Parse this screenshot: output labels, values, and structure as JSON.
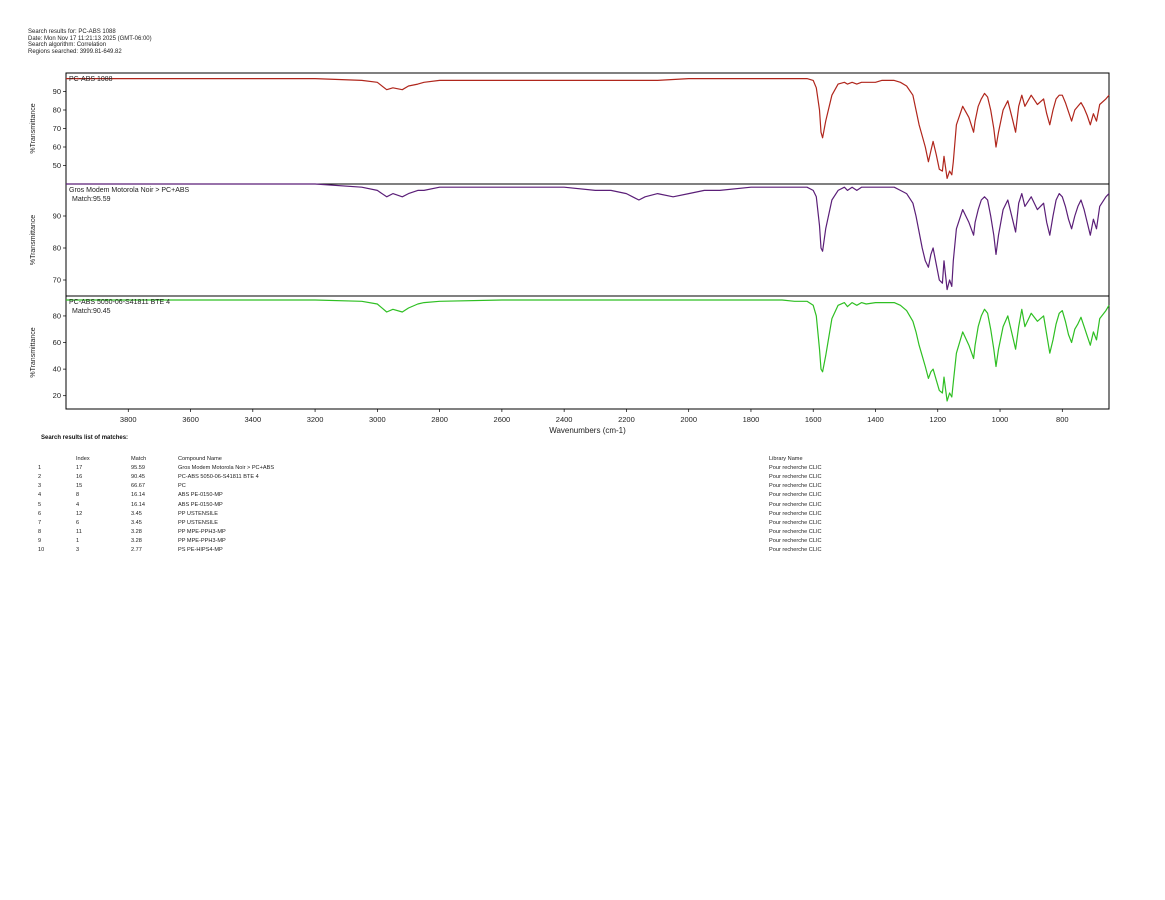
{
  "header": {
    "line1": "Search results for: PC-ABS 1088",
    "line2": "Date: Mon Nov 17 11:21:13 2025 (GMT-06:00)",
    "line3": "Search algorithm: Correlation",
    "line4": "Regions searched: 3999.81-649.82"
  },
  "chart_data": [
    {
      "type": "line",
      "label": "PC-ABS 1088",
      "match_label": "",
      "color": "#b0261c",
      "ylabel": "%Transmittance",
      "ylim": [
        40,
        100
      ],
      "yticks": [
        50,
        60,
        70,
        80,
        90
      ],
      "xlim": [
        4000,
        650
      ],
      "x": [
        4000,
        3700,
        3500,
        3200,
        3050,
        3000,
        2970,
        2950,
        2920,
        2900,
        2870,
        2850,
        2800,
        2600,
        2400,
        2300,
        2200,
        2100,
        2000,
        1900,
        1800,
        1700,
        1660,
        1620,
        1600,
        1590,
        1580,
        1575,
        1570,
        1560,
        1540,
        1520,
        1500,
        1490,
        1475,
        1460,
        1445,
        1430,
        1400,
        1380,
        1360,
        1340,
        1320,
        1300,
        1280,
        1270,
        1260,
        1250,
        1240,
        1230,
        1222,
        1215,
        1205,
        1195,
        1185,
        1180,
        1170,
        1162,
        1155,
        1150,
        1140,
        1120,
        1100,
        1085,
        1080,
        1070,
        1060,
        1050,
        1040,
        1030,
        1020,
        1013,
        1005,
        990,
        975,
        960,
        950,
        940,
        930,
        920,
        900,
        880,
        860,
        850,
        840,
        830,
        820,
        810,
        800,
        790,
        780,
        770,
        760,
        750,
        740,
        730,
        720,
        710,
        700,
        690,
        680,
        660,
        650
      ],
      "y": [
        97,
        97,
        97,
        97,
        96,
        95,
        91,
        92,
        91,
        93,
        94,
        95,
        96,
        96,
        96,
        96,
        96,
        96,
        97,
        97,
        97,
        97,
        97,
        97,
        96,
        92,
        80,
        68,
        65,
        74,
        88,
        94,
        95,
        94,
        95,
        94,
        95,
        95,
        95,
        96,
        96,
        96,
        95,
        93,
        88,
        80,
        72,
        66,
        60,
        52,
        58,
        63,
        56,
        48,
        47,
        55,
        43,
        47,
        45,
        52,
        72,
        82,
        76,
        68,
        74,
        82,
        86,
        89,
        87,
        80,
        70,
        60,
        68,
        80,
        85,
        75,
        68,
        82,
        88,
        82,
        88,
        83,
        86,
        78,
        72,
        80,
        86,
        88,
        88,
        84,
        79,
        74,
        80,
        82,
        84,
        81,
        77,
        72,
        78,
        74,
        83,
        86,
        88
      ]
    },
    {
      "type": "line",
      "label": "Gros Modem Motorola Noir > PC+ABS",
      "match_label": "Match:95.59",
      "color": "#5b1f78",
      "ylabel": "%Transmittance",
      "ylim": [
        65,
        100
      ],
      "yticks": [
        70,
        80,
        90
      ],
      "xlim": [
        4000,
        650
      ],
      "x": [
        4000,
        3700,
        3500,
        3200,
        3050,
        3000,
        2970,
        2950,
        2920,
        2900,
        2870,
        2850,
        2800,
        2600,
        2400,
        2300,
        2250,
        2200,
        2180,
        2160,
        2140,
        2100,
        2050,
        2000,
        1950,
        1900,
        1800,
        1700,
        1660,
        1620,
        1600,
        1590,
        1580,
        1575,
        1570,
        1560,
        1540,
        1520,
        1500,
        1490,
        1475,
        1460,
        1445,
        1430,
        1400,
        1380,
        1360,
        1340,
        1320,
        1300,
        1280,
        1270,
        1260,
        1250,
        1240,
        1230,
        1222,
        1215,
        1205,
        1195,
        1185,
        1180,
        1170,
        1162,
        1155,
        1150,
        1140,
        1120,
        1100,
        1085,
        1080,
        1070,
        1060,
        1050,
        1040,
        1030,
        1020,
        1013,
        1005,
        990,
        975,
        960,
        950,
        940,
        930,
        920,
        900,
        880,
        860,
        850,
        840,
        830,
        820,
        810,
        800,
        790,
        780,
        770,
        760,
        750,
        740,
        730,
        720,
        710,
        700,
        690,
        680,
        660,
        650
      ],
      "y": [
        100,
        100,
        100,
        100,
        99,
        98,
        96,
        97,
        96,
        97,
        98,
        98,
        99,
        99,
        99,
        98,
        98,
        97,
        96,
        95,
        96,
        97,
        96,
        97,
        98,
        98,
        99,
        99,
        99,
        99,
        98,
        96,
        87,
        80,
        79,
        86,
        95,
        98,
        99,
        98,
        99,
        98,
        99,
        99,
        99,
        99,
        99,
        99,
        98,
        97,
        94,
        90,
        85,
        80,
        76,
        74,
        78,
        80,
        75,
        70,
        69,
        76,
        67,
        70,
        68,
        76,
        86,
        92,
        88,
        84,
        88,
        92,
        95,
        96,
        95,
        90,
        84,
        78,
        84,
        92,
        95,
        89,
        85,
        94,
        97,
        93,
        96,
        92,
        94,
        88,
        84,
        90,
        95,
        97,
        96,
        93,
        89,
        86,
        90,
        93,
        95,
        92,
        88,
        84,
        89,
        86,
        93,
        96,
        97
      ]
    },
    {
      "type": "line",
      "label": "PC-ABS 5050-06-S41811 BTE 4",
      "match_label": "Match:90.45",
      "color": "#2fbf23",
      "ylabel": "%Transmittance",
      "ylim": [
        10,
        95
      ],
      "yticks": [
        20,
        40,
        60,
        80
      ],
      "xlim": [
        4000,
        650
      ],
      "x": [
        4000,
        3700,
        3500,
        3200,
        3050,
        3000,
        2970,
        2950,
        2920,
        2900,
        2870,
        2850,
        2800,
        2600,
        2400,
        2300,
        2200,
        2100,
        2000,
        1900,
        1800,
        1700,
        1660,
        1620,
        1600,
        1590,
        1580,
        1575,
        1570,
        1560,
        1540,
        1520,
        1500,
        1490,
        1475,
        1460,
        1445,
        1430,
        1400,
        1380,
        1360,
        1340,
        1320,
        1300,
        1280,
        1270,
        1260,
        1250,
        1240,
        1230,
        1222,
        1215,
        1205,
        1195,
        1185,
        1180,
        1170,
        1162,
        1155,
        1150,
        1140,
        1120,
        1100,
        1085,
        1080,
        1070,
        1060,
        1050,
        1040,
        1030,
        1020,
        1013,
        1005,
        990,
        975,
        960,
        950,
        940,
        930,
        920,
        900,
        880,
        860,
        850,
        840,
        830,
        820,
        810,
        800,
        790,
        780,
        770,
        760,
        750,
        740,
        730,
        720,
        710,
        700,
        690,
        680,
        660,
        650
      ],
      "y": [
        92,
        92,
        92,
        92,
        91,
        89,
        83,
        85,
        83,
        86,
        89,
        90,
        91,
        92,
        92,
        92,
        92,
        92,
        92,
        92,
        92,
        92,
        91,
        91,
        88,
        80,
        55,
        40,
        38,
        50,
        78,
        88,
        90,
        87,
        90,
        88,
        90,
        89,
        90,
        90,
        90,
        90,
        88,
        84,
        76,
        68,
        58,
        50,
        42,
        33,
        38,
        40,
        32,
        24,
        22,
        34,
        16,
        22,
        19,
        30,
        52,
        68,
        58,
        48,
        58,
        72,
        80,
        85,
        82,
        70,
        55,
        42,
        55,
        72,
        80,
        65,
        55,
        72,
        85,
        72,
        82,
        76,
        80,
        66,
        52,
        62,
        74,
        82,
        84,
        76,
        66,
        60,
        70,
        74,
        79,
        72,
        65,
        58,
        68,
        62,
        78,
        84,
        88
      ]
    }
  ],
  "xaxis": {
    "label": "Wavenumbers (cm-1)",
    "ticks": [
      3800,
      3600,
      3400,
      3200,
      3000,
      2800,
      2600,
      2400,
      2200,
      2000,
      1800,
      1600,
      1400,
      1200,
      1000,
      800
    ]
  },
  "results": {
    "title": "Search results list of matches:",
    "columns": {
      "index": "Index",
      "match": "Match",
      "name": "Compound Name",
      "library": "Library Name"
    },
    "rows": [
      {
        "rank": "1",
        "index": "17",
        "match": "95.59",
        "name": "Gros Modem Motorola Noir > PC+ABS",
        "library": "Pour recherche CLIC"
      },
      {
        "rank": "2",
        "index": "16",
        "match": "90.45",
        "name": "PC-ABS 5050-06-S41811 BTE 4",
        "library": "Pour recherche CLIC"
      },
      {
        "rank": "3",
        "index": "15",
        "match": "66.67",
        "name": "PC",
        "library": "Pour recherche CLIC"
      },
      {
        "rank": "4",
        "index": "8",
        "match": "16.14",
        "name": "ABS PE-0150-MP",
        "library": "Pour recherche CLIC"
      },
      {
        "rank": "5",
        "index": "4",
        "match": "16.14",
        "name": "ABS PE-0150-MP",
        "library": "Pour recherche CLIC"
      },
      {
        "rank": "6",
        "index": "12",
        "match": "3.45",
        "name": "PP USTENSILE",
        "library": "Pour recherche CLIC"
      },
      {
        "rank": "7",
        "index": "6",
        "match": "3.45",
        "name": "PP USTENSILE",
        "library": "Pour recherche CLIC"
      },
      {
        "rank": "8",
        "index": "11",
        "match": "3.28",
        "name": "PP MPE-PPH3-MP",
        "library": "Pour recherche CLIC"
      },
      {
        "rank": "9",
        "index": "1",
        "match": "3.28",
        "name": "PP MPE-PPH3-MP",
        "library": "Pour recherche CLIC"
      },
      {
        "rank": "10",
        "index": "3",
        "match": "2.77",
        "name": "PS PE-HIPS4-MP",
        "library": "Pour recherche CLIC"
      }
    ]
  }
}
